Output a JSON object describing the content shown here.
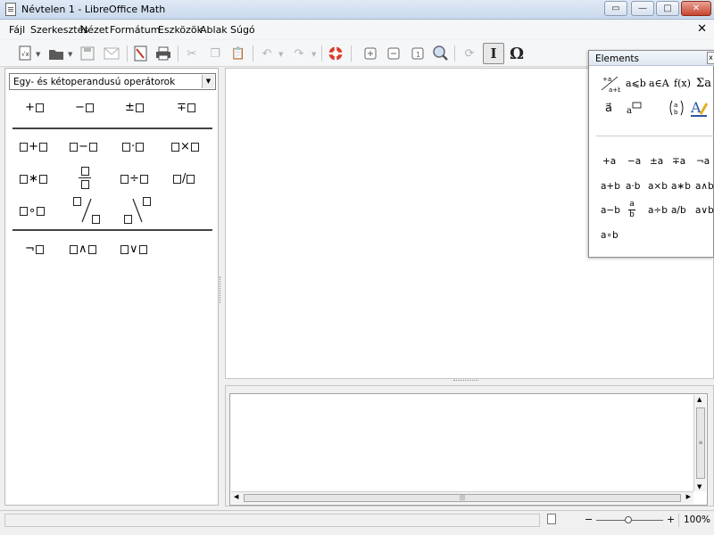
{
  "window": {
    "title": "Névtelen 1 - LibreOffice Math",
    "restore_label": "▭",
    "minimize_label": "—",
    "maximize_label": "□",
    "close_label": "✕"
  },
  "menu": {
    "items": [
      "Fájl",
      "Szerkesztés",
      "Nézet",
      "Formátum",
      "Eszközök",
      "Ablak",
      "Súgó"
    ],
    "doc_close": "✕"
  },
  "toolbar": {
    "icons": [
      "new-document-icon",
      "open-folder-icon",
      "save-icon",
      "email-icon",
      "export-pdf-icon",
      "print-icon",
      "cut-icon",
      "copy-icon",
      "paste-icon",
      "undo-icon",
      "redo-icon",
      "help-lifebuoy-icon",
      "zoom-in-icon",
      "zoom-out-icon",
      "show-all-icon",
      "zoom-icon",
      "update-icon",
      "formula-cursor-icon",
      "symbols-omega-icon"
    ],
    "omega_glyph": "Ω",
    "cursor_glyph": "I"
  },
  "left_panel": {
    "category": "Egy- és kétoperandusú operátorok",
    "ops_row1": [
      "+",
      "−",
      "±",
      "∓"
    ],
    "ops_row2": [
      "+",
      "−",
      "·",
      "×"
    ],
    "ops_row3": [
      "∗",
      "÷",
      "/"
    ],
    "ops_row4": [
      "∘"
    ],
    "ops_row5": [
      "¬",
      "∧",
      "∨"
    ]
  },
  "elements_panel": {
    "title": "Elements",
    "close": "x",
    "categories": [
      {
        "name": "unary-binary",
        "glyph": "+a/a+b"
      },
      {
        "name": "relations",
        "glyph": "a⩽b"
      },
      {
        "name": "set-operations",
        "glyph": "a∈A"
      },
      {
        "name": "functions",
        "glyph": "f(x)"
      },
      {
        "name": "operators",
        "glyph": "Σa"
      },
      {
        "name": "attributes",
        "glyph": "a⃗"
      },
      {
        "name": "others",
        "glyph": "a💬"
      },
      {
        "name": "brackets",
        "glyph": "(a b)"
      },
      {
        "name": "formats",
        "glyph": "A"
      }
    ],
    "row1": [
      "+a",
      "−a",
      "±a",
      "∓a",
      "¬a"
    ],
    "row2": [
      "a+b",
      "a·b",
      "a×b",
      "a∗b",
      "a∧b"
    ],
    "row3_a": "a−b",
    "row3_frac_num": "a",
    "row3_frac_den": "b",
    "row3_b": [
      "a÷b",
      "a/b",
      "a∨b"
    ],
    "row4": [
      "a∘b"
    ]
  },
  "statusbar": {
    "zoom": "100%",
    "minus": "−",
    "plus": "+"
  }
}
